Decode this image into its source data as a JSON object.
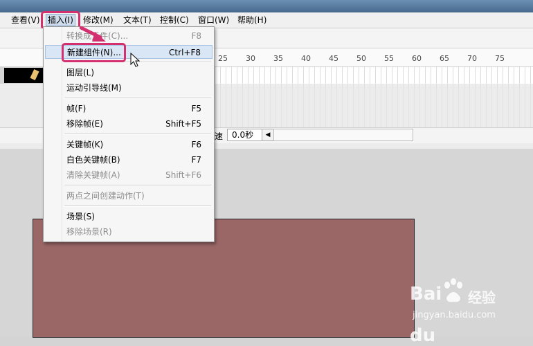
{
  "menubar": {
    "items": [
      {
        "label": "查看(V)"
      },
      {
        "label": "插入(I)"
      },
      {
        "label": "修改(M)"
      },
      {
        "label": "文本(T)"
      },
      {
        "label": "控制(C)"
      },
      {
        "label": "窗口(W)"
      },
      {
        "label": "帮助(H)"
      }
    ]
  },
  "timeline": {
    "ruler_numbers": [
      "25",
      "30",
      "35",
      "40",
      "45",
      "50",
      "55",
      "60",
      "65",
      "70",
      "75"
    ],
    "status_char": "速",
    "time_value": "0.0秒"
  },
  "insert_menu": {
    "items": [
      {
        "label": "转换成元件(C)...",
        "shortcut": "F8",
        "disabled": true
      },
      {
        "label": "新建组件(N)...",
        "shortcut": "Ctrl+F8",
        "disabled": false,
        "highlighted": true
      },
      {
        "label": "图层(L)",
        "shortcut": "",
        "disabled": false
      },
      {
        "label": "运动引导线(M)",
        "shortcut": "",
        "disabled": false
      },
      {
        "label": "帧(F)",
        "shortcut": "F5",
        "disabled": false
      },
      {
        "label": "移除帧(E)",
        "shortcut": "Shift+F5",
        "disabled": false
      },
      {
        "label": "关键帧(K)",
        "shortcut": "F6",
        "disabled": false
      },
      {
        "label": "白色关键帧(B)",
        "shortcut": "F7",
        "disabled": false
      },
      {
        "label": "清除关键帧(A)",
        "shortcut": "Shift+F6",
        "disabled": true
      },
      {
        "label": "两点之间创建动作(T)",
        "shortcut": "",
        "disabled": true
      },
      {
        "label": "场景(S)",
        "shortcut": "",
        "disabled": false
      },
      {
        "label": "移除场景(R)",
        "shortcut": "",
        "disabled": true
      }
    ]
  },
  "watermark": {
    "brand": "Bai",
    "brand_suffix": "du",
    "cn": "经验",
    "url": "jingyan.baidu.com"
  },
  "colors": {
    "highlight": "#d2306e",
    "stage": "#9a6766"
  }
}
